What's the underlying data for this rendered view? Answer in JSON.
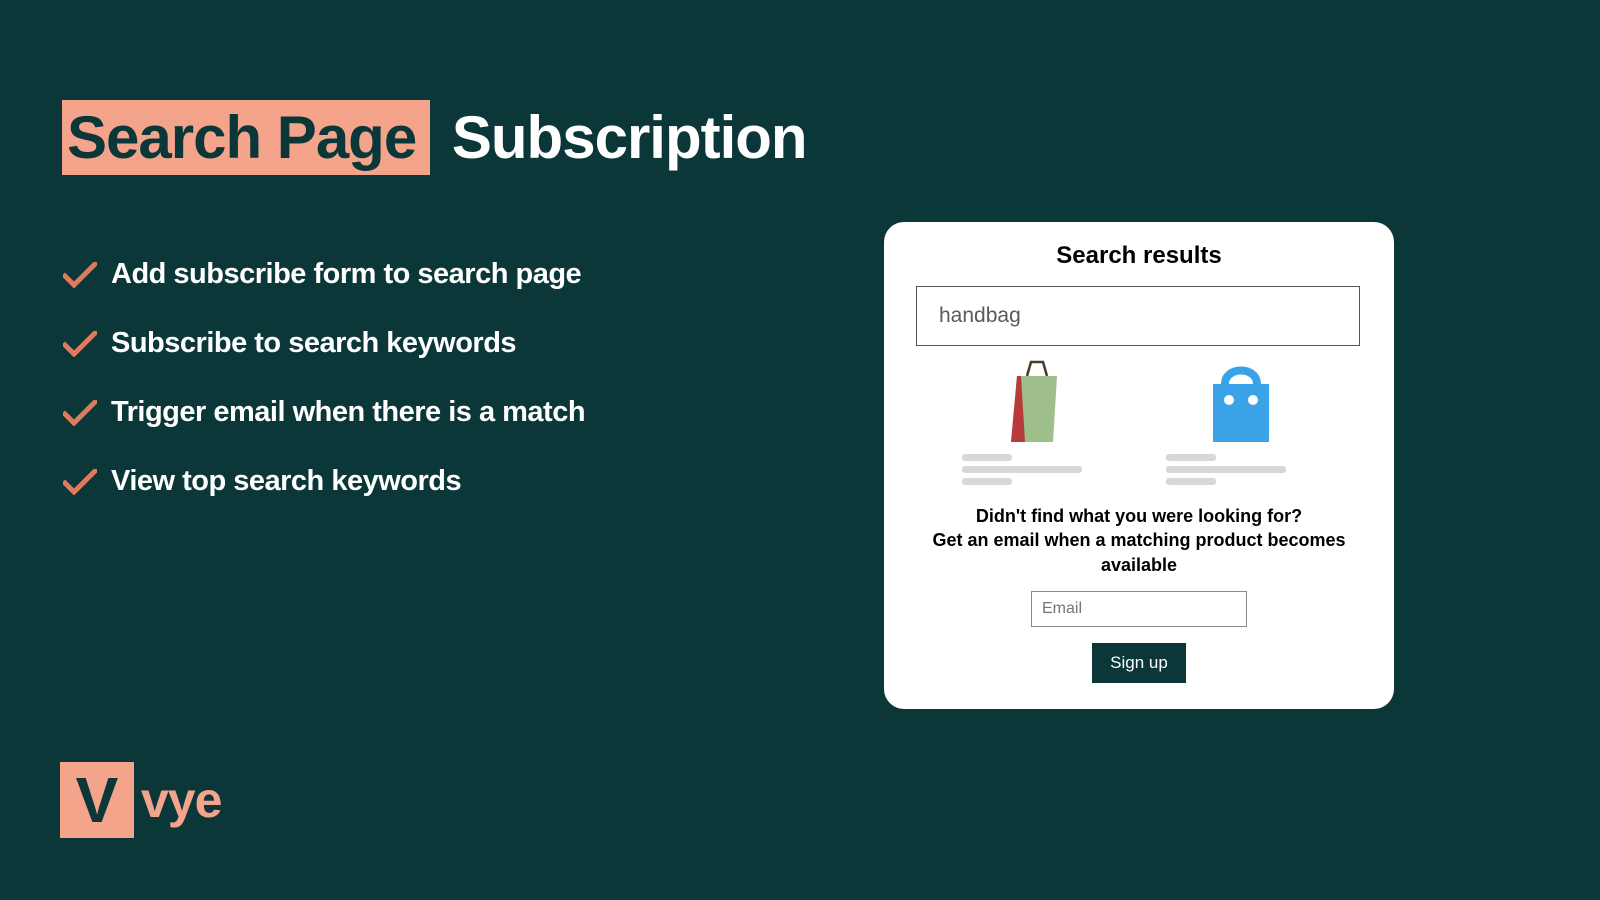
{
  "heading": {
    "highlight": "Search Page",
    "rest": "Subscription"
  },
  "features": [
    "Add subscribe form to search page",
    "Subscribe to search keywords",
    "Trigger email when there is a match",
    "View top search keywords"
  ],
  "card": {
    "title": "Search results",
    "search_value": "handbag",
    "cta_line1": "Didn't find what you were looking for?",
    "cta_line2": "Get an email when a matching product becomes available",
    "email_placeholder": "Email",
    "signup_label": "Sign up"
  },
  "logo": {
    "letter": "V",
    "text": "vye"
  },
  "colors": {
    "background": "#0b3739",
    "accent": "#f5a48c",
    "card_bg": "#ffffff",
    "bag_blue": "#3aa3e8",
    "bag_green": "#9ebf8b"
  }
}
